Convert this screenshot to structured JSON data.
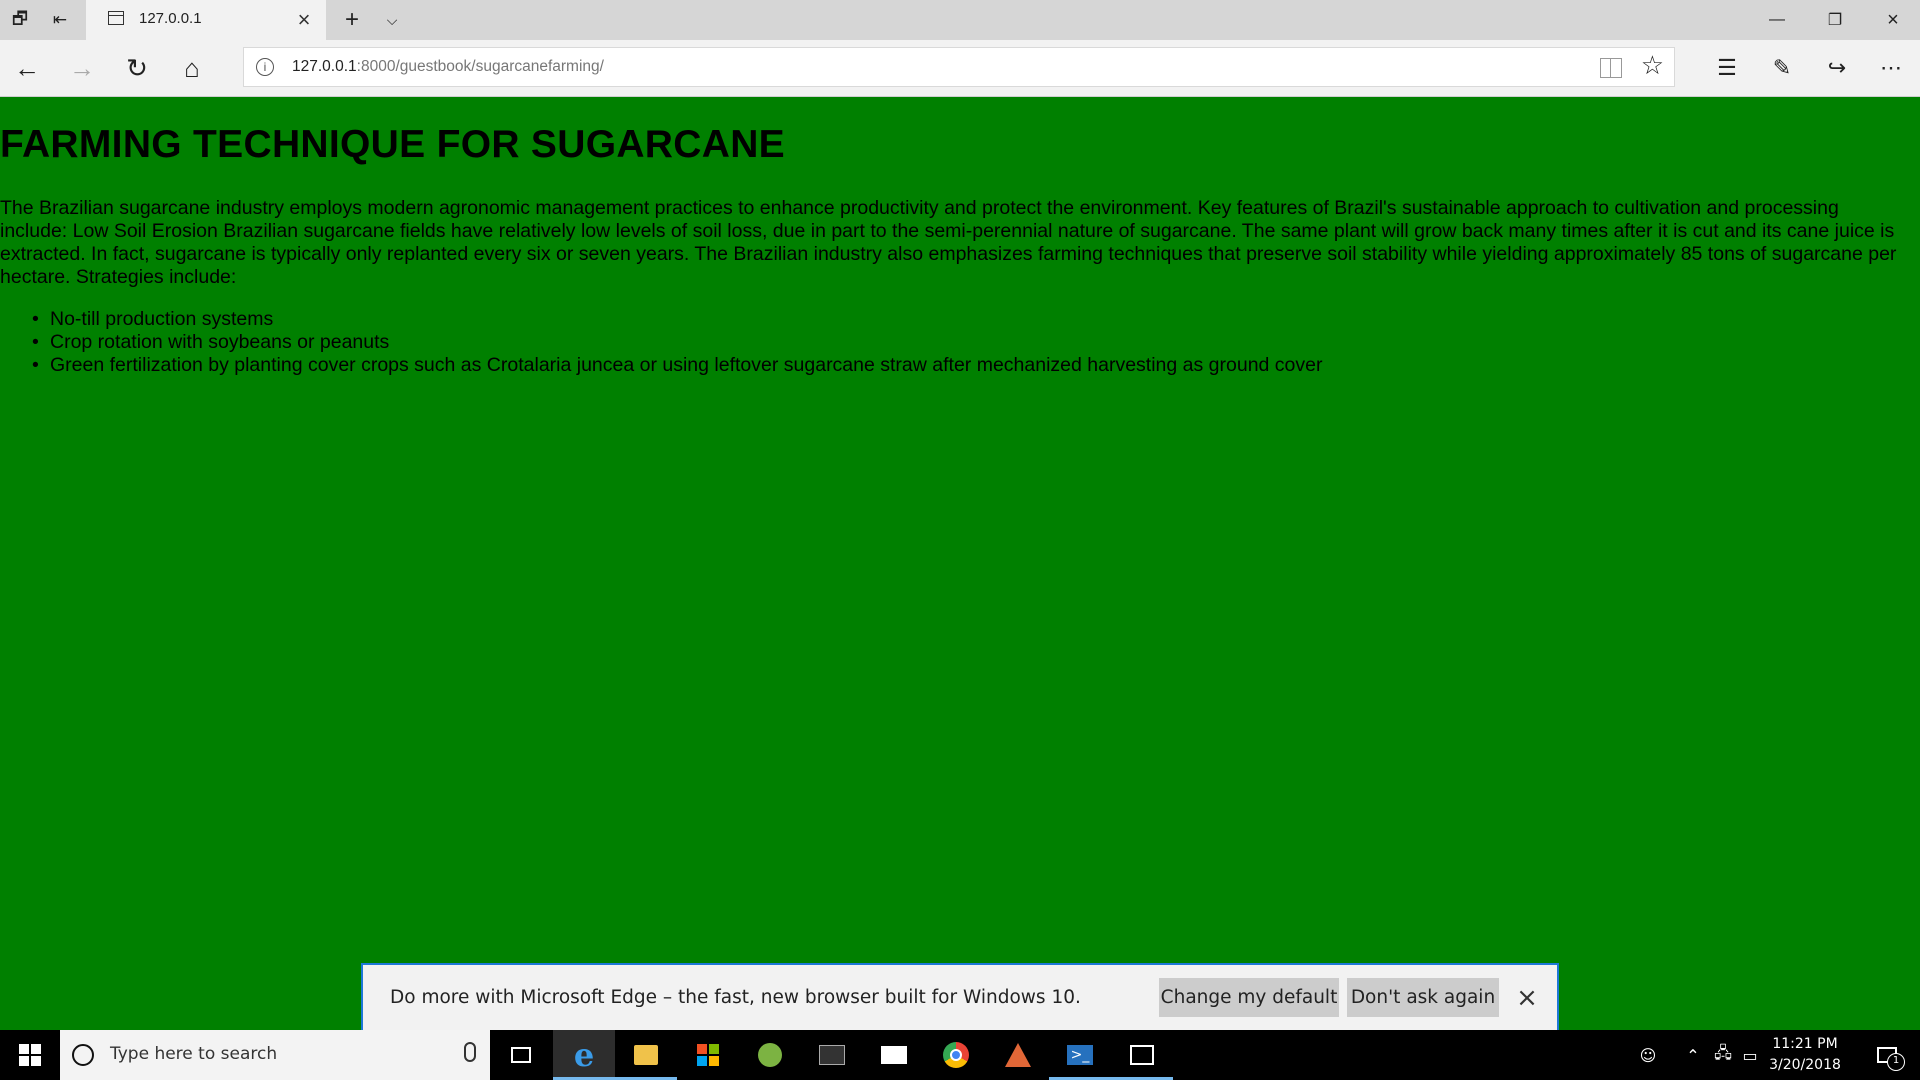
{
  "browser": {
    "tab_title": "127.0.0.1",
    "url_host": "127.0.0.1",
    "url_path": ":8000/guestbook/sugarcanefarming/"
  },
  "page": {
    "heading": "FARMING TECHNIQUE FOR SUGARCANE",
    "paragraph": "The Brazilian sugarcane industry employs modern agronomic management practices to enhance productivity and protect the environment. Key features of Brazil's sustainable approach to cultivation and processing include: Low Soil Erosion Brazilian sugarcane fields have relatively low levels of soil loss, due in part to the semi-perennial nature of sugarcane. The same plant will grow back many times after it is cut and its cane juice is extracted. In fact, sugarcane is typically only replanted every six or seven years. The Brazilian industry also emphasizes farming techniques that preserve soil stability while yielding approximately 85 tons of sugarcane per hectare. Strategies include:",
    "list": [
      "No-till production systems",
      "Crop rotation with soybeans or peanuts",
      "Green fertilization by planting cover crops such as Crotalaria juncea or using leftover sugarcane straw after mechanized harvesting as ground cover"
    ],
    "background_color": "#008000"
  },
  "notification": {
    "message": "Do more with Microsoft Edge – the fast, new browser built for Windows 10.",
    "primary_button": "Change my default",
    "secondary_button": "Don't ask again"
  },
  "taskbar": {
    "search_placeholder": "Type here to search",
    "time": "11:21 PM",
    "date": "3/20/2018",
    "notification_count": "1"
  }
}
